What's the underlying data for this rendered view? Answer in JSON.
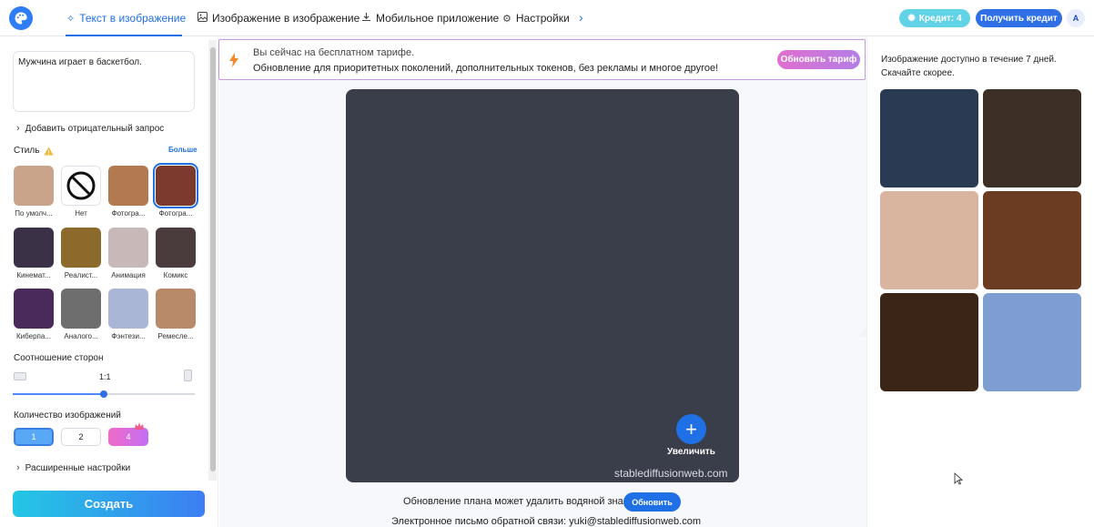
{
  "nav": {
    "tabs": [
      {
        "label": "Текст в изображение",
        "icon": "magic-wand-icon"
      },
      {
        "label": "Изображение в изображение",
        "icon": "image-icon"
      },
      {
        "label": "Мобильное приложение",
        "icon": "download-icon"
      },
      {
        "label": "Настройки",
        "icon": "gear-icon"
      }
    ],
    "active_tab": 0,
    "credit_label": "Кредит: 4",
    "get_credit_label": "Получить кредит",
    "avatar_letter": "A"
  },
  "left": {
    "prompt_value": "Мужчина играет в баскетбол.",
    "negative_prompt_label": "Добавить отрицательный запрос",
    "style_label": "Стиль",
    "more_label": "Больше",
    "styles": [
      {
        "label": "По умолч...",
        "icon": "style-default-thumbnail"
      },
      {
        "label": "Нет",
        "icon": "no-style-icon"
      },
      {
        "label": "Фотогра...",
        "icon": "style-photo-thumbnail"
      },
      {
        "label": "Фотогра...",
        "icon": "style-photo-featured-thumbnail"
      },
      {
        "label": "Кинемат...",
        "icon": "style-cinematic-thumbnail"
      },
      {
        "label": "Реалист...",
        "icon": "style-realistic-thumbnail"
      },
      {
        "label": "Анимация",
        "icon": "style-anime-thumbnail"
      },
      {
        "label": "Комикс",
        "icon": "style-comic-thumbnail"
      },
      {
        "label": "Киберпа...",
        "icon": "style-cyberpunk-thumbnail"
      },
      {
        "label": "Аналого...",
        "icon": "style-analog-thumbnail"
      },
      {
        "label": "Фэнтези...",
        "icon": "style-fantasy-thumbnail"
      },
      {
        "label": "Ремесле...",
        "icon": "style-craft-thumbnail"
      }
    ],
    "selected_style": 3,
    "aspect_label": "Соотношение сторон",
    "aspect_value": "1:1",
    "aspect_slider_fraction": 0.5,
    "count_label": "Количество изображений",
    "count_options": [
      "1",
      "2",
      "4"
    ],
    "selected_count": 0,
    "advanced_label": "Расширенные настройки",
    "create_label": "Создать"
  },
  "main": {
    "banner_line1": "Вы сейчас на бесплатном тарифе.",
    "banner_line2": "Обновление для приоритетных поколений, дополнительных токенов, без рекламы и многое другое!",
    "upgrade_label": "Обновить тариф",
    "zoom_label": "Увеличить",
    "watermark": "stablediffusionweb.com",
    "watermark_note": "Обновление плана может удалить водяной знак",
    "refresh_label": "Обновить",
    "feedback_email": "Электронное письмо обратной связи: yuki@stablediffusionweb.com"
  },
  "right": {
    "availability_text": "Изображение доступно в течение 7 дней. Скачайте скорее."
  },
  "colors": {
    "accent": "#1f6fe5",
    "credit": "#62d2e6",
    "upgrade_gradient_start": "#e06fcf",
    "upgrade_gradient_end": "#b37ee6",
    "create_gradient_start": "#23c7e4",
    "create_gradient_end": "#3c7ef3"
  }
}
